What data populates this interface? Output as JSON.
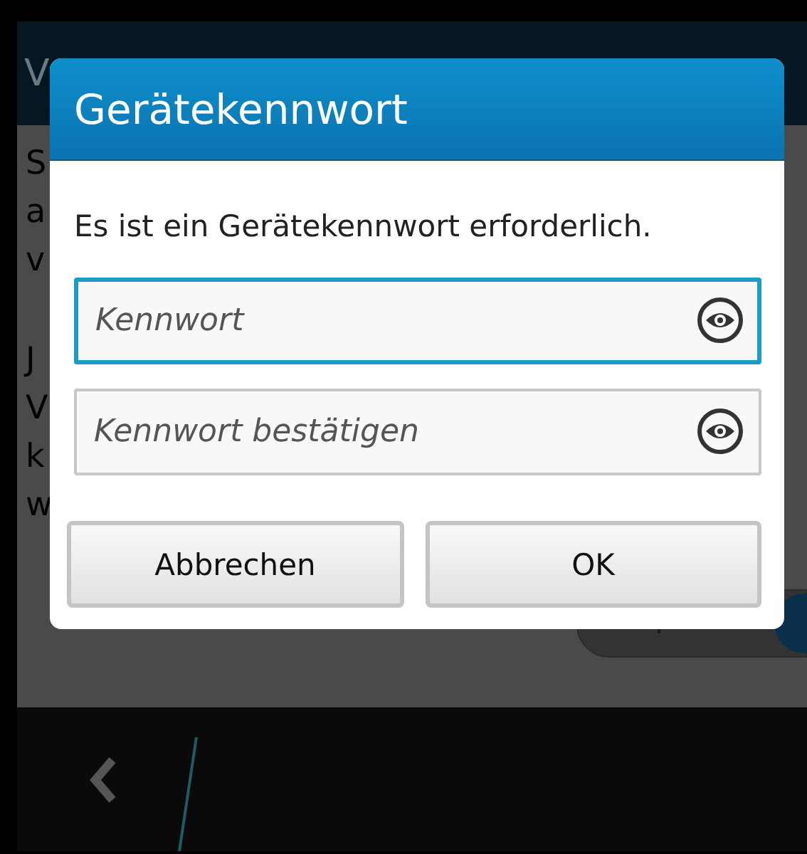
{
  "background": {
    "title": "V",
    "lines": [
      "S",
      "a",
      "v"
    ],
    "lines_2": [
      "J",
      "V",
      "k",
      "w"
    ],
    "setting": {
      "on": true
    }
  },
  "dialog": {
    "title": "Gerätekennwort",
    "message": "Es ist ein Gerätekennwort erforderlich.",
    "fields": [
      {
        "placeholder": "Kennwort",
        "focused": true
      },
      {
        "placeholder": "Kennwort bestätigen",
        "focused": false
      }
    ],
    "buttons": [
      "Abbrechen",
      "OK"
    ]
  }
}
